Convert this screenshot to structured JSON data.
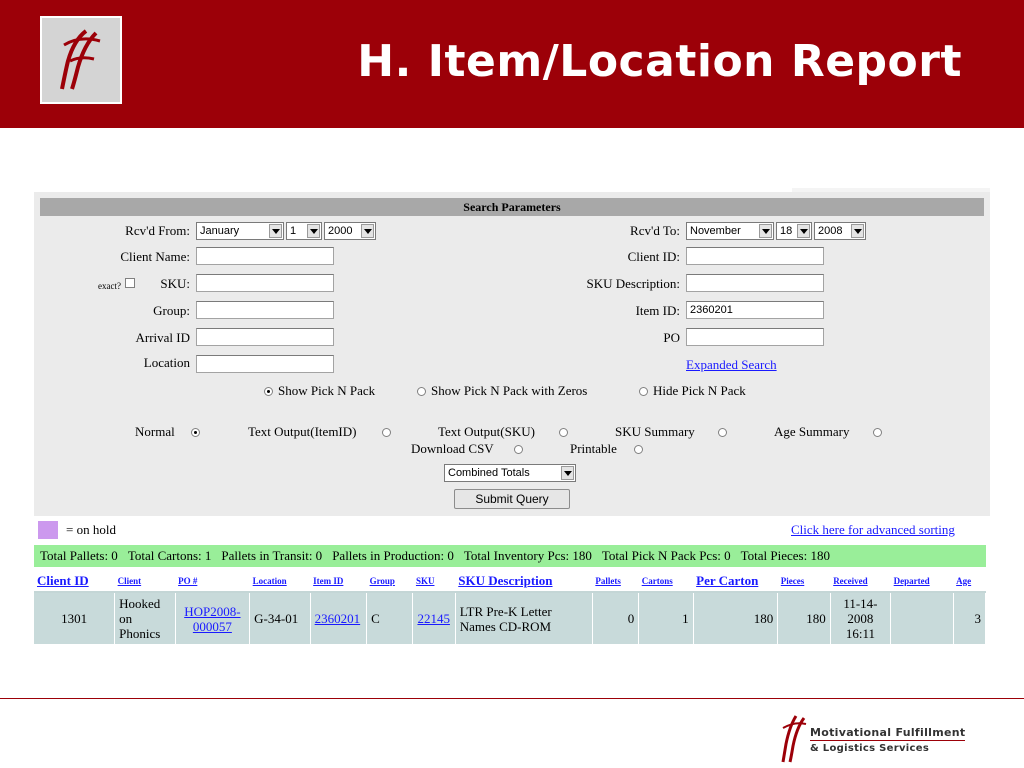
{
  "slide": {
    "title": "H. Item/Location Report",
    "footer_line1": "Motivational Fulfillment",
    "footer_line2": "& Logistics Services",
    "accent_color": "#9c0008"
  },
  "search": {
    "header": "Search Parameters",
    "rcvd_from_label": "Rcv'd From:",
    "rcvd_from_month": "January",
    "rcvd_from_day": "1",
    "rcvd_from_year": "2000",
    "rcvd_to_label": "Rcv'd To:",
    "rcvd_to_month": "November",
    "rcvd_to_day": "18",
    "rcvd_to_year": "2008",
    "client_name_label": "Client Name:",
    "client_name_value": "",
    "client_id_label": "Client ID:",
    "client_id_value": "",
    "exact_label": "exact?",
    "sku_label": "SKU:",
    "sku_value": "",
    "sku_desc_label": "SKU Description:",
    "sku_desc_value": "",
    "group_label": "Group:",
    "group_value": "",
    "item_id_label": "Item ID:",
    "item_id_value": "2360201",
    "arrival_id_label": "Arrival ID",
    "arrival_id_value": "",
    "po_label": "PO",
    "po_value": "",
    "location_label": "Location",
    "location_value": "",
    "expanded_search": "Expanded Search",
    "pick_options": [
      "Show Pick N Pack",
      "Show Pick N Pack with Zeros",
      "Hide Pick N Pack"
    ],
    "pick_selected": 0,
    "output_options": [
      "Normal",
      "Text Output(ItemID)",
      "Text Output(SKU)",
      "SKU Summary",
      "Age Summary",
      "Download CSV",
      "Printable"
    ],
    "output_selected": 0,
    "totals_select": "Combined Totals",
    "submit_label": "Submit Query"
  },
  "legend": {
    "hold_label": "= on hold",
    "hold_color": "#cc99ee",
    "advanced_sorting": "Click here for advanced sorting"
  },
  "totals": {
    "pallets": "Total Pallets: 0",
    "cartons": "Total Cartons: 1",
    "in_transit": "Pallets in Transit: 0",
    "in_production": "Pallets in Production: 0",
    "inventory": "Total Inventory Pcs: 180",
    "pick_n_pack": "Total Pick N Pack Pcs: 0",
    "pieces": "Total Pieces: 180",
    "bar_color": "#99ee99"
  },
  "table": {
    "columns": [
      "Client ID",
      "Client",
      "PO #",
      "Location",
      "Item ID",
      "Group",
      "SKU",
      "SKU Description",
      "Pallets",
      "Cartons",
      "Per Carton",
      "Pieces",
      "Received",
      "Departed",
      "Age"
    ],
    "rows": [
      {
        "client_id": "1301",
        "client": "Hooked on Phonics",
        "po": "HOP2008-000057",
        "location": "G-34-01",
        "item_id": "2360201",
        "group": "C",
        "sku": "22145",
        "sku_description": "LTR Pre-K Letter Names CD-ROM",
        "pallets": "0",
        "cartons": "1",
        "per_carton": "180",
        "pieces": "180",
        "received": "11-14-2008 16:11",
        "departed": "",
        "age": "3"
      }
    ]
  }
}
